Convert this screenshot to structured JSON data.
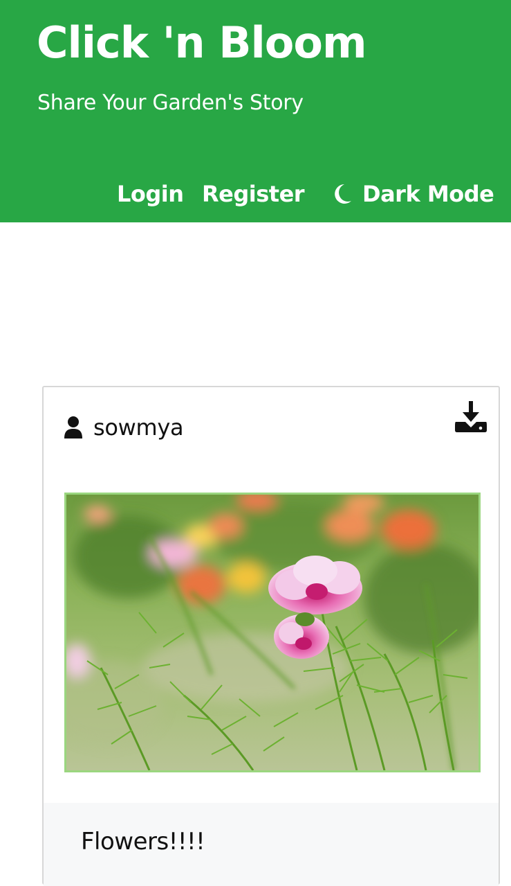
{
  "header": {
    "title": "Click 'n Bloom",
    "tagline": "Share Your Garden's Story",
    "background_color": "#28a745"
  },
  "nav": {
    "login_label": "Login",
    "register_label": "Register",
    "dark_mode_label": "Dark Mode",
    "dark_mode_icon": "moon-icon"
  },
  "post": {
    "author": "sowmya",
    "author_icon": "user-icon",
    "download_icon": "download-icon",
    "image_description_icon": "flower-photo",
    "caption": "Flowers!!!!"
  }
}
